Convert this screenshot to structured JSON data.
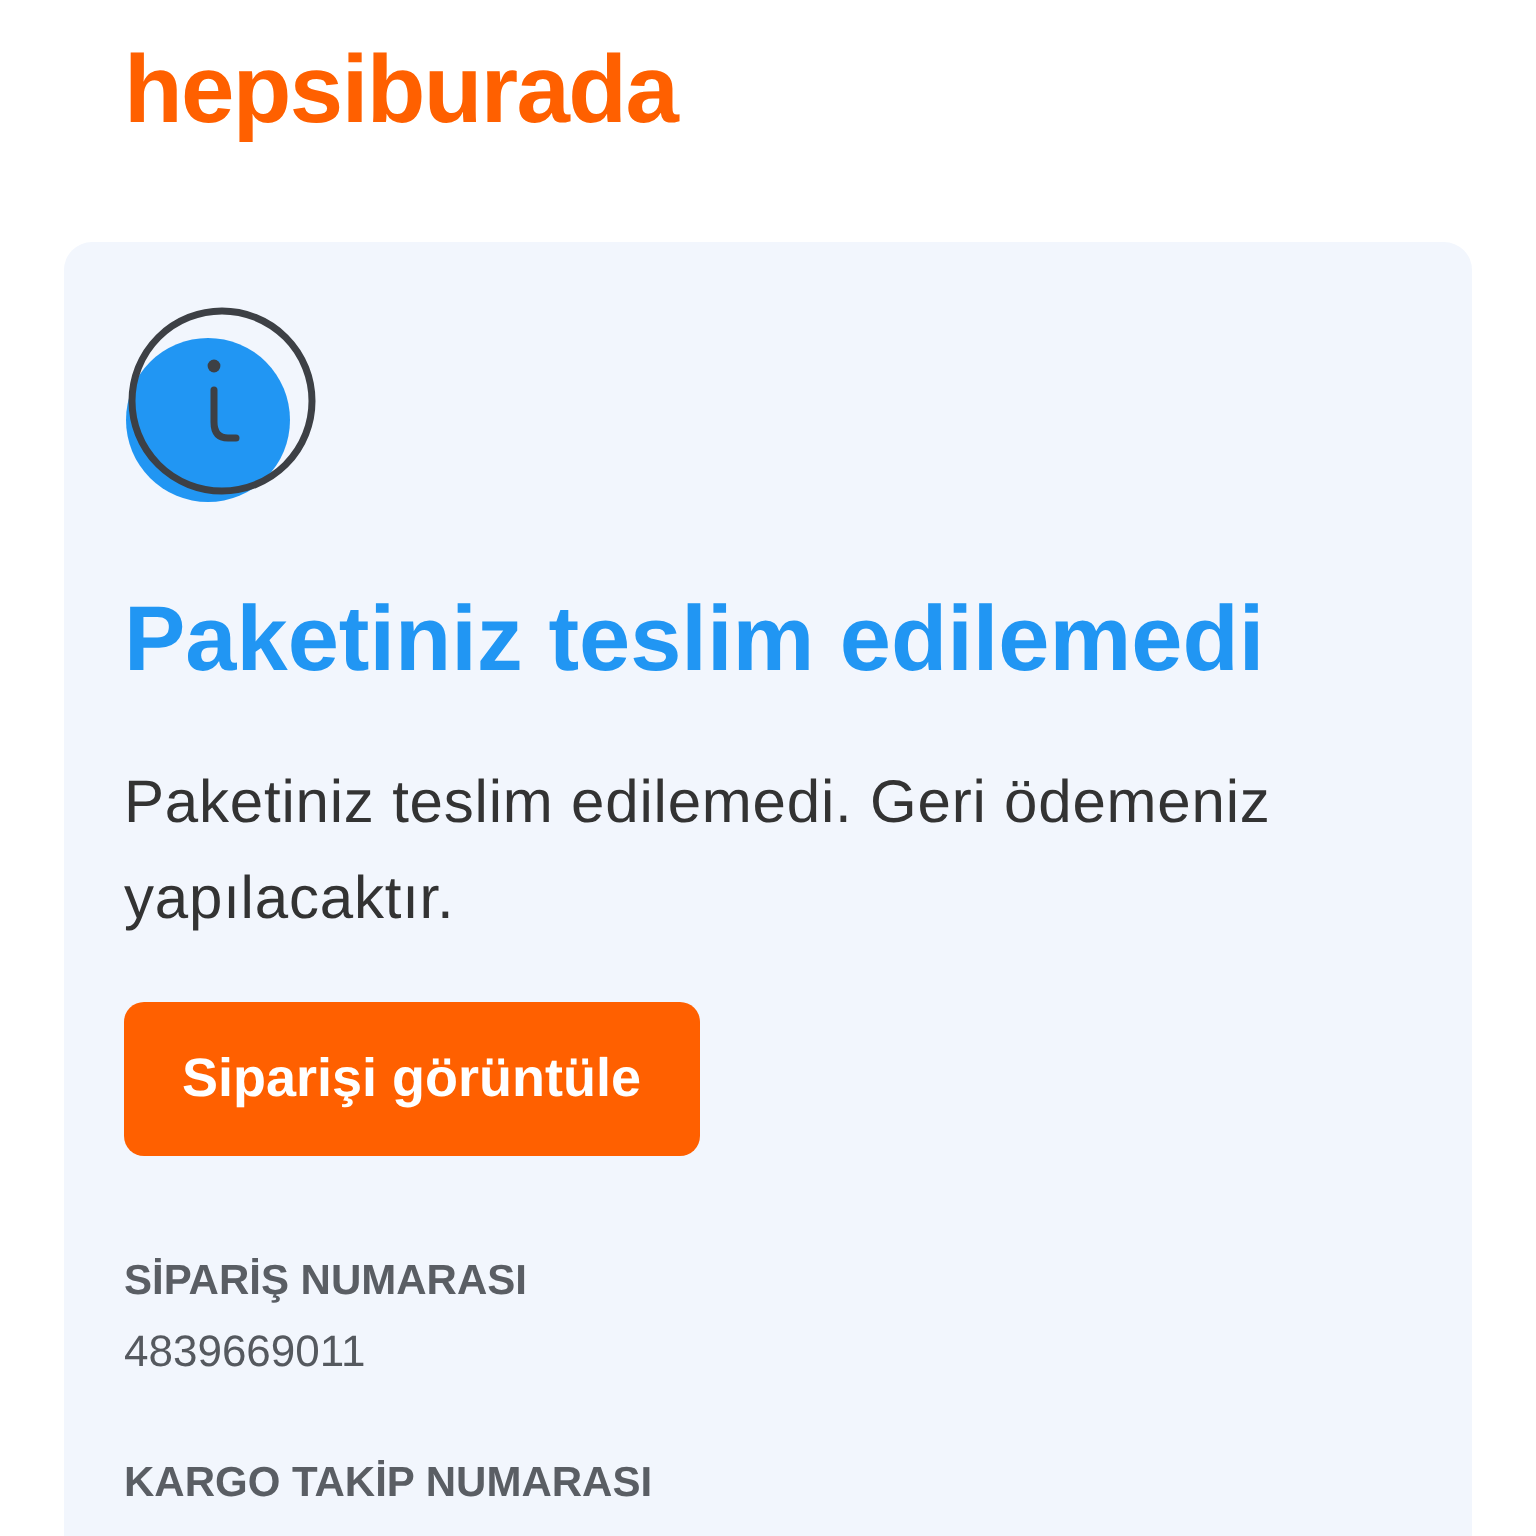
{
  "logo": {
    "text": "hepsiburada"
  },
  "notice": {
    "title": "Paketiniz teslim edilemedi",
    "message": "Paketiniz teslim edilemedi. Geri ödemeniz yapılacaktır.",
    "button": "Siparişi görüntüle",
    "details": [
      {
        "label": "SİPARİŞ NUMARASI",
        "value": "4839669011"
      },
      {
        "label": "KARGO TAKİP NUMARASI"
      }
    ]
  }
}
